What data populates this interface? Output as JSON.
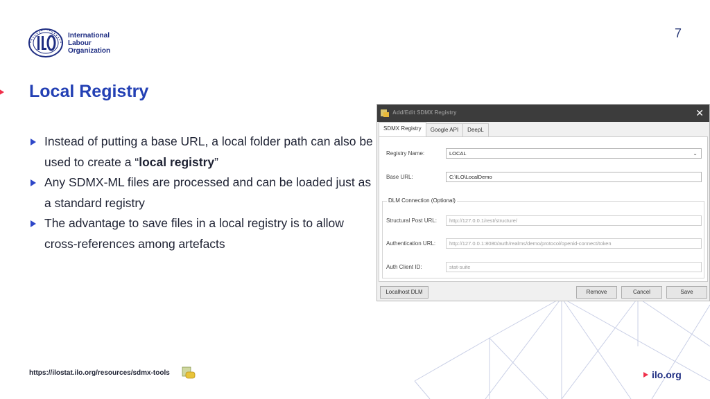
{
  "page_number": "7",
  "logo": {
    "line1": "International",
    "line2": "Labour",
    "line3": "Organization"
  },
  "slide": {
    "title": "Local Registry",
    "bullets": [
      {
        "before": "Instead of putting a base URL, a local folder path can also be used to create a “",
        "bold": "local registry",
        "after": "”"
      },
      {
        "text": "Any SDMX-ML files are processed and can be loaded just as a standard registry"
      },
      {
        "text": "The advantage to save files in a local registry is to allow cross-references among artefacts"
      }
    ]
  },
  "footer": {
    "url": "https://ilostat.ilo.org/resources/sdmx-tools",
    "link": "ilo.org"
  },
  "colors": {
    "accent_red": "#f0304b",
    "title_blue": "#2340b4",
    "brand_navy": "#1e2d82"
  },
  "dialog": {
    "title": "Add/Edit SDMX Registry",
    "close": "✕",
    "tabs": [
      "SDMX Registry",
      "Google API",
      "DeepL"
    ],
    "registry_name_label": "Registry Name:",
    "registry_name_value": "LOCAL",
    "base_url_label": "Base URL:",
    "base_url_value": "C:\\ILO\\LocalDemo",
    "dlm_group_label": "DLM Connection (Optional)",
    "structural_label": "Structural Post URL:",
    "structural_value": "http://127.0.0.1/rest/structure/",
    "auth_label": "Authentication URL:",
    "auth_value": "http://127.0.0.1:8080/auth/realms/demo/protocol/openid-connect/token",
    "client_label": "Auth Client ID:",
    "client_value": "stat-suite",
    "buttons": {
      "localhost": "Localhost DLM",
      "remove": "Remove",
      "cancel": "Cancel",
      "save": "Save"
    }
  }
}
